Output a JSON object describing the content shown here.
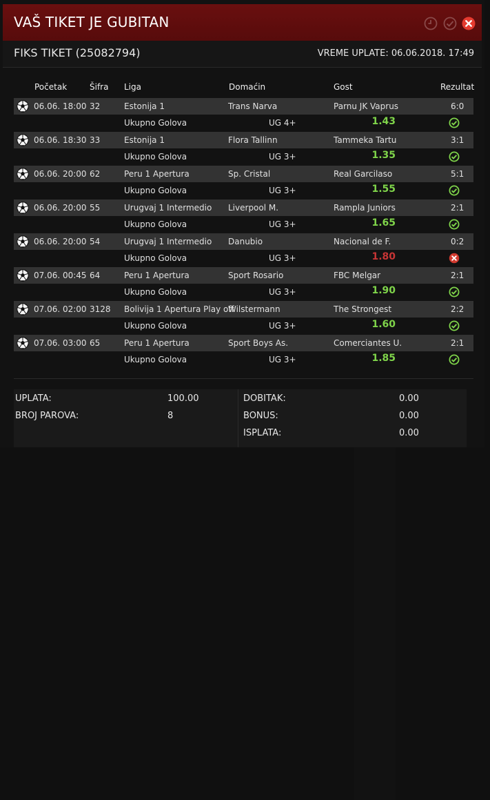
{
  "window": {
    "title": "VAŠ TIKET JE GUBITAN",
    "ticket_title": "FIKS TIKET (25082794)",
    "paid_time": "VREME UPLATE: 06.06.2018. 17:49"
  },
  "columns": {
    "start": "Početak",
    "code": "Šifra",
    "league": "Liga",
    "home": "Domaćin",
    "away": "Gost",
    "result": "Rezultat"
  },
  "matches": [
    {
      "start": "06.06. 18:00",
      "code": "32",
      "league": "Estonija 1",
      "home": "Trans Narva",
      "away": "Parnu JK Vaprus",
      "result": "6:0",
      "bet_type": "Ukupno Golova",
      "bet": "UG 4+",
      "odd": "1.43",
      "status": "win"
    },
    {
      "start": "06.06. 18:30",
      "code": "33",
      "league": "Estonija 1",
      "home": "Flora Tallinn",
      "away": "Tammeka Tartu",
      "result": "3:1",
      "bet_type": "Ukupno Golova",
      "bet": "UG 3+",
      "odd": "1.35",
      "status": "win"
    },
    {
      "start": "06.06. 20:00",
      "code": "62",
      "league": "Peru 1 Apertura",
      "home": "Sp. Cristal",
      "away": "Real Garcilaso",
      "result": "5:1",
      "bet_type": "Ukupno Golova",
      "bet": "UG 3+",
      "odd": "1.55",
      "status": "win"
    },
    {
      "start": "06.06. 20:00",
      "code": "55",
      "league": "Urugvaj 1 Intermedio",
      "home": "Liverpool M.",
      "away": "Rampla Juniors",
      "result": "2:1",
      "bet_type": "Ukupno Golova",
      "bet": "UG 3+",
      "odd": "1.65",
      "status": "win"
    },
    {
      "start": "06.06. 20:00",
      "code": "54",
      "league": "Urugvaj 1 Intermedio",
      "home": "Danubio",
      "away": "Nacional de F.",
      "result": "0:2",
      "bet_type": "Ukupno Golova",
      "bet": "UG 3+",
      "odd": "1.80",
      "status": "loss"
    },
    {
      "start": "07.06. 00:45",
      "code": "64",
      "league": "Peru 1 Apertura",
      "home": "Sport Rosario",
      "away": "FBC Melgar",
      "result": "2:1",
      "bet_type": "Ukupno Golova",
      "bet": "UG 3+",
      "odd": "1.90",
      "status": "win"
    },
    {
      "start": "07.06. 02:00",
      "code": "3128",
      "league": "Bolivija 1 Apertura Play off",
      "home": "Wilstermann",
      "away": "The Strongest",
      "result": "2:2",
      "bet_type": "Ukupno Golova",
      "bet": "UG 3+",
      "odd": "1.60",
      "status": "win"
    },
    {
      "start": "07.06. 03:00",
      "code": "65",
      "league": "Peru 1 Apertura",
      "home": "Sport Boys As.",
      "away": "Comerciantes U.",
      "result": "2:1",
      "bet_type": "Ukupno Golova",
      "bet": "UG 3+",
      "odd": "1.85",
      "status": "win"
    }
  ],
  "summary": {
    "stake_label": "UPLATA:",
    "stake_value": "100.00",
    "pairs_label": "BROJ PAROVA:",
    "pairs_value": "8",
    "winnings_label": "DOBITAK:",
    "winnings_value": "0.00",
    "bonus_label": "BONUS:",
    "bonus_value": "0.00",
    "payout_label": "ISPLATA:",
    "payout_value": "0.00"
  },
  "colors": {
    "header_bg": "#5e0d0d",
    "win": "#7fd44a",
    "loss": "#c73535"
  }
}
